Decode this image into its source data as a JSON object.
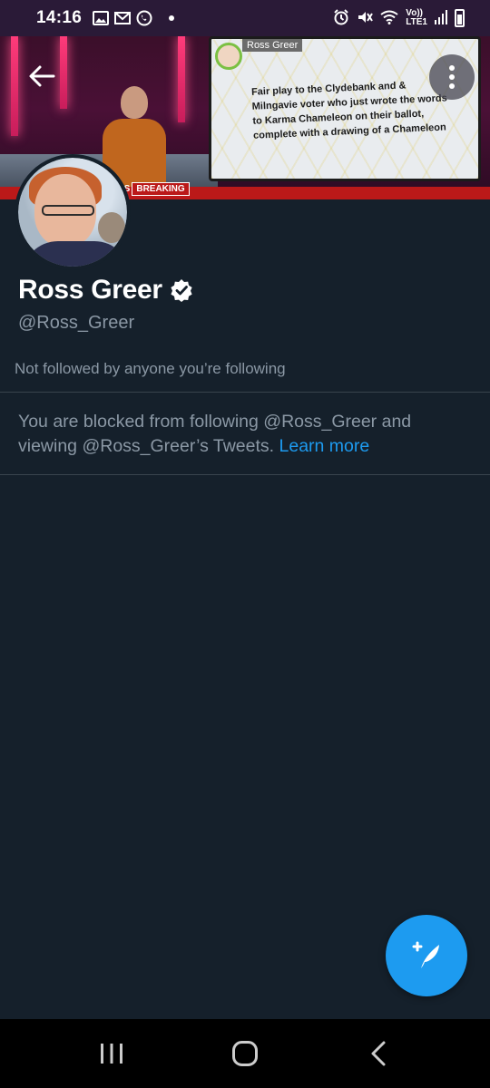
{
  "status_bar": {
    "time": "14:16",
    "icons_left": [
      "gallery-icon",
      "gmail-icon",
      "whatsapp-icon",
      "notification-dot-icon"
    ],
    "icons_right": [
      "alarm-icon",
      "mute-icon",
      "wifi-icon",
      "volte-icon",
      "signal-icon",
      "battery-icon"
    ],
    "volte_label": "Vo))",
    "lte_label": "LTE1"
  },
  "banner": {
    "screen_name": "Ross Greer",
    "screen_text": "Fair play to the Clydebank and & Milngavie voter who just wrote the words to Karma Chameleon on their ballot, complete with a drawing of a Chameleon",
    "ticker_prefix": "VS",
    "ticker_label": "BREAKING"
  },
  "profile": {
    "display_name": "Ross Greer",
    "verified": true,
    "handle": "@Ross_Greer",
    "followed_by": "Not followed by anyone you’re following"
  },
  "blocked_notice": {
    "text": "You are blocked from following @Ross_Greer and viewing @Ross_Greer’s Tweets.",
    "link": "Learn more"
  },
  "colors": {
    "background": "#15202b",
    "accent": "#1d9bf0",
    "secondary_text": "#8b98a5",
    "divider": "#38444d",
    "status_bar": "#2a1a37"
  }
}
